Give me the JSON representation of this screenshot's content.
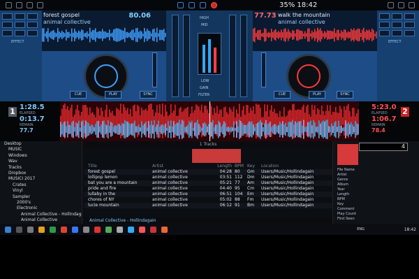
{
  "system_status": "35%  18:42",
  "deck_left": {
    "number": "1",
    "title": "forest gospel",
    "artist": "animal collective",
    "bpm": "80.06",
    "elapsed": "1:28.5",
    "remain": "0:13.7",
    "bpm_small": "77.7",
    "elapsed_label": "ELAPSED",
    "remain_label": "REMAIN",
    "buttons": [
      "CUE",
      "PLAY",
      "SYNC"
    ],
    "pad_label": "EFFECT"
  },
  "deck_right": {
    "number": "2",
    "title": "walk the mountain",
    "artist": "animal collective",
    "bpm": "77.73",
    "elapsed": "5:23.0",
    "remain": "1:06.7",
    "bpm_small": "78.4",
    "elapsed_label": "ELAPSED",
    "remain_label": "REMAIN",
    "buttons": [
      "CUE",
      "PLAY",
      "SYNC"
    ],
    "pad_label": "EFFECT"
  },
  "mixer": {
    "labels": [
      "HIGH",
      "MID",
      "LOW",
      "GAIN",
      "FILTER"
    ]
  },
  "folders": [
    "Desktop",
    "MUSIC",
    "Windows",
    "Wav",
    "Tracks",
    "Dropbox",
    "MUSICI 2017",
    "Crates",
    "Vinyl",
    "Sampler",
    "2000's",
    "Electronic",
    "Animal Collective - Hollindagain",
    "Animal Collective"
  ],
  "browser_tab": "1 Tracks",
  "track_columns": [
    "Title",
    "Artist",
    "Length",
    "BPM",
    "Key",
    "Location"
  ],
  "tracks": [
    {
      "title": "forest gospel",
      "artist": "animal collective",
      "length": "04:28",
      "bpm": "80",
      "key": "Gm",
      "path": "Users/Music/Hollindagain"
    },
    {
      "title": "lollipop lemon",
      "artist": "animal collective",
      "length": "03:51",
      "bpm": "112",
      "key": "Dm",
      "path": "Users/Music/Hollindagain"
    },
    {
      "title": "bat you are a mountain",
      "artist": "animal collective",
      "length": "05:21",
      "bpm": "77",
      "key": "Am",
      "path": "Users/Music/Hollindagain"
    },
    {
      "title": "pride and fire",
      "artist": "animal collective",
      "length": "04:40",
      "bpm": "95",
      "key": "Cm",
      "path": "Users/Music/Hollindagain"
    },
    {
      "title": "lullaby in the",
      "artist": "animal collective",
      "length": "06:51",
      "bpm": "104",
      "key": "Em",
      "path": "Users/Music/Hollindagain"
    },
    {
      "title": "chores of NY",
      "artist": "animal collective",
      "length": "05:02",
      "bpm": "88",
      "key": "Fm",
      "path": "Users/Music/Hollindagain"
    },
    {
      "title": "lucie mountain",
      "artist": "animal collective",
      "length": "06:12",
      "bpm": "91",
      "key": "Bm",
      "path": "Users/Music/Hollindagain"
    }
  ],
  "browser_status": "Animal Collective - Hollindagain",
  "search_value": "4",
  "side_info": [
    "File Name",
    "Artist",
    "Genre",
    "Album",
    "Year",
    "Length",
    "BPM",
    "Key",
    "Comment",
    "Play Count",
    "First Seen",
    "Last Played"
  ],
  "taskbar": {
    "clock": "18:42",
    "lang": "ENG"
  },
  "colors": {
    "deck_left_accent": "#3fa0ff",
    "deck_right_accent": "#ff3a3a",
    "skin_blue": "#1d4c86"
  }
}
